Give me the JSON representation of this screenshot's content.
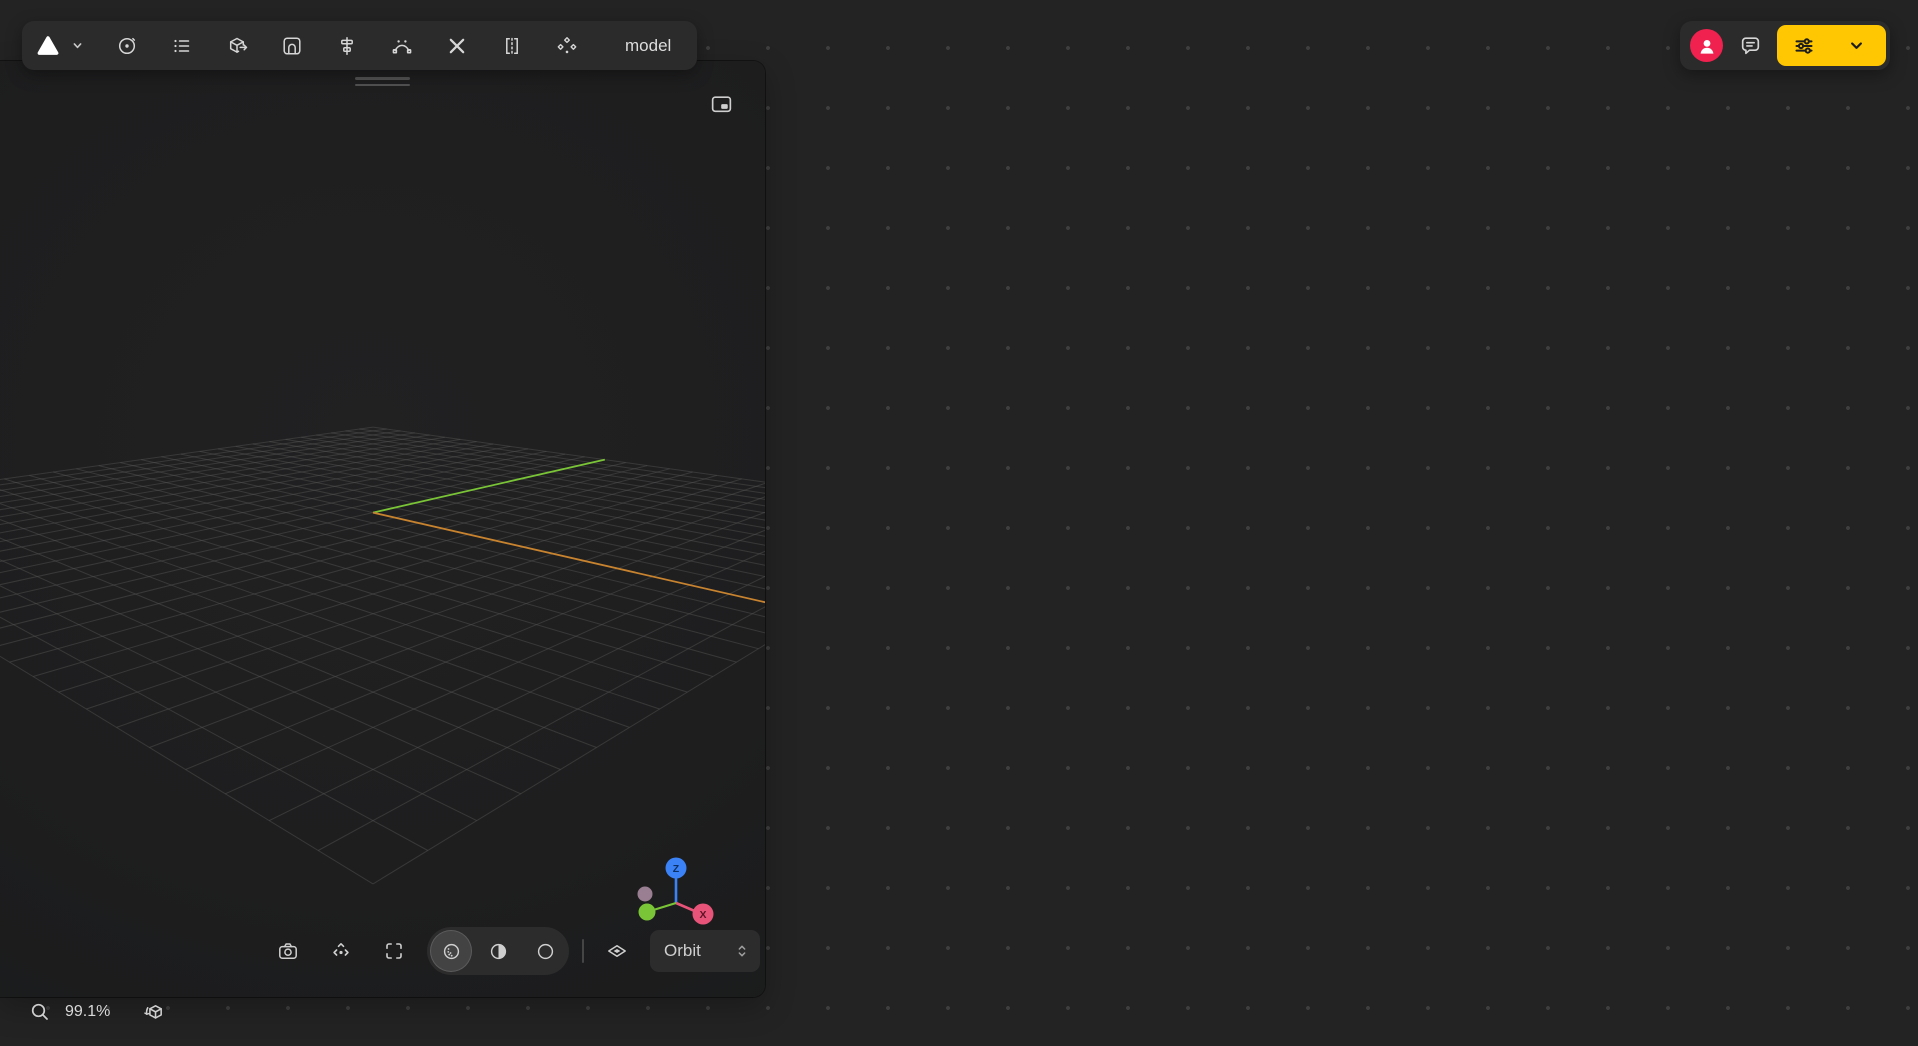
{
  "colors": {
    "bg": "#232323",
    "dot": "#3e3e3e",
    "panel": "#1e1e1f",
    "bar": "#2b2b2b",
    "accent": "#ffc702",
    "avatar-red": "#f0214f",
    "grid-line": "#585858",
    "axis-green": "#7ac437",
    "axis-orange": "#c8832f",
    "axis-blue": "#3b82f6",
    "axis-red": "#e85479",
    "axis-mauve": "#a9899d"
  },
  "main_toolbar": {
    "scene_name": "model",
    "icons": [
      "spline-logo",
      "chevron-down",
      "orbit-target",
      "layers-list",
      "export-cube",
      "library-arch",
      "align",
      "pen-path",
      "edit-tools",
      "mirror",
      "scatter"
    ]
  },
  "top_right": {
    "icons": [
      "user-avatar",
      "comments-bubble",
      "filter-sliders",
      "chevron-down"
    ]
  },
  "viewport": {
    "camera_mode": "Orbit",
    "gizmo": {
      "z": "Z",
      "x": "X"
    },
    "toolbar_icons": [
      "camera-capture",
      "navigate-move",
      "expand-view",
      "shaded-sphere",
      "half-shaded-sphere",
      "wireframe-sphere",
      "ground-plane"
    ],
    "render_mode_selected_index": 0
  },
  "status_bar": {
    "zoom_level": "99.1%"
  }
}
